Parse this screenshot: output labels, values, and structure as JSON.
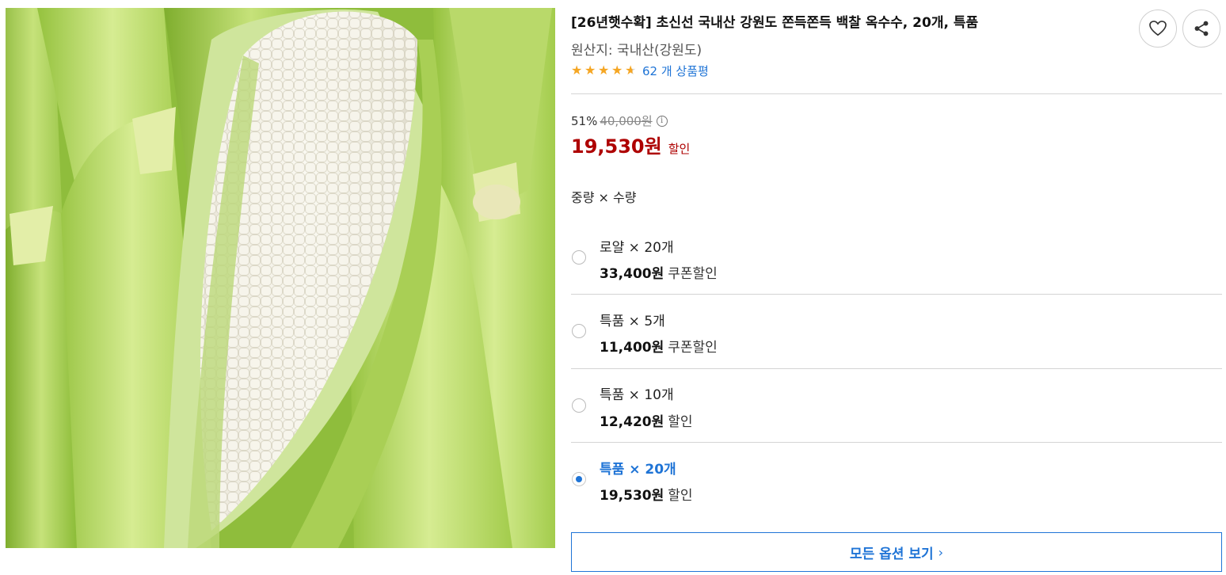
{
  "product": {
    "title": "[26년햇수확] 초신선 국내산 강원도 쫀득쫀득 백찰 옥수수, 20개, 특품",
    "origin": "원산지: 국내산(강원도)",
    "rating": 4.5,
    "review_count_text": "62 개 상품평"
  },
  "actions": {
    "wishlist_icon": "heart-icon",
    "share_icon": "share-icon"
  },
  "price": {
    "discount_rate": "51%",
    "original_price": "40,000원",
    "info_icon": "i",
    "sale_price": "19,530원",
    "sale_tag": "할인"
  },
  "options": {
    "header": "중량 × 수량",
    "items": [
      {
        "name": "로얄 × 20개",
        "price": "33,400원",
        "tag": "쿠폰할인",
        "selected": false
      },
      {
        "name": "특품 × 5개",
        "price": "11,400원",
        "tag": "쿠폰할인",
        "selected": false
      },
      {
        "name": "특품 × 10개",
        "price": "12,420원",
        "tag": "할인",
        "selected": false
      },
      {
        "name": "특품 × 20개",
        "price": "19,530원",
        "tag": "할인",
        "selected": true
      }
    ],
    "view_all_label": "모든 옵션 보기",
    "view_all_chevron": "›"
  },
  "colors": {
    "accent": "#1f74d6",
    "sale_red": "#ae0000",
    "star": "#f5a623"
  }
}
